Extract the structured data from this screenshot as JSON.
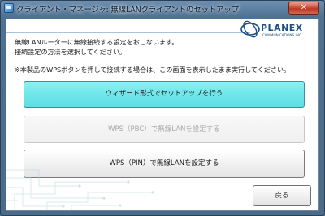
{
  "window": {
    "title": "クライアント・マネージャ: 無線LANクライアントのセットアップ",
    "close_label": "✕"
  },
  "logo": {
    "brand": "PLANEX",
    "tagline": "COMMUNICATIONS INC."
  },
  "message": {
    "line1": "無線LANルーターに無線接続する設定をおこないます。",
    "line2": "接続設定の方法を選択してください。",
    "note": "※本製品のWPSボタンを押して接続する場合は、この画面を表示したまま実行してください。"
  },
  "buttons": {
    "wizard": "ウィザード形式でセットアップを行う",
    "wps_pbc": "WPS（PBC）で無線LANを設定する",
    "wps_pin": "WPS（PIN）で無線LANを設定する",
    "back": "戻る"
  },
  "colors": {
    "accent_button": "#6fe6ea",
    "brand": "#1d4f86"
  }
}
